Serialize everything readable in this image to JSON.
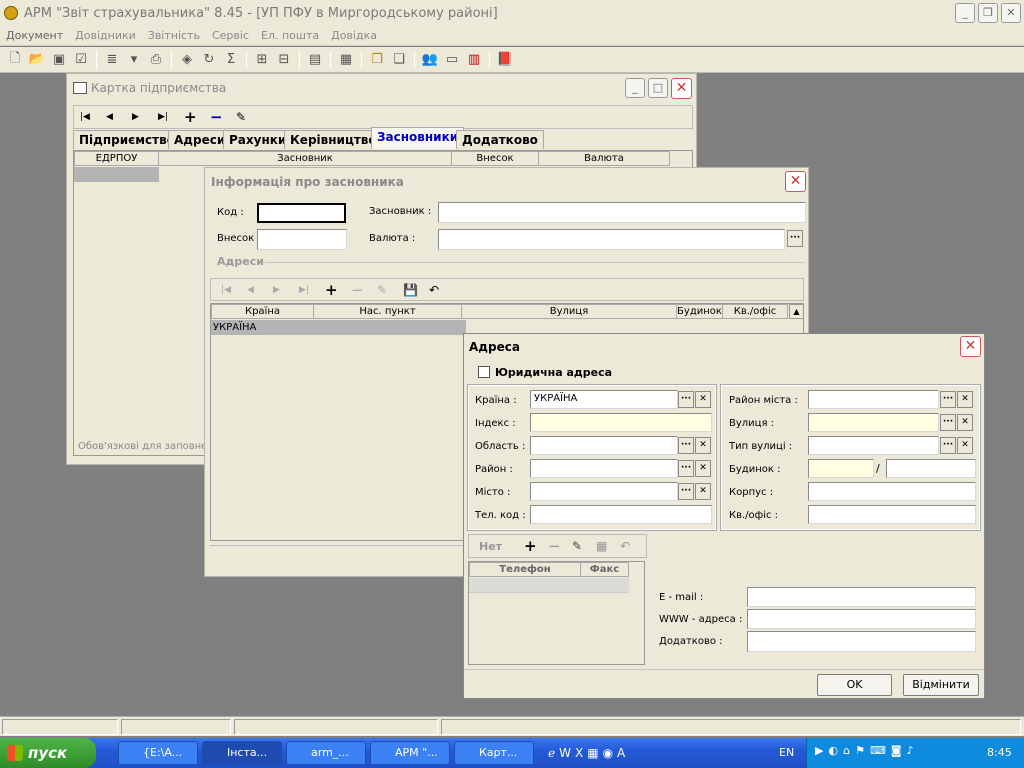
{
  "app": {
    "title": "АРМ \"Звіт страхувальника\" 8.45 - [УП ПФУ в Миргородському районі]"
  },
  "menu": [
    "Документ",
    "Довідники",
    "Звітність",
    "Сервіс",
    "Ел. пошта",
    "Довідка"
  ],
  "card": {
    "title": "Картка підприємства",
    "tabs": [
      "Підприємство",
      "Адреси",
      "Рахунки",
      "Керівництво",
      "Засновники",
      "Додатково"
    ],
    "active_tab": "Засновники",
    "columns": [
      "ЕДРПОУ",
      "Засновник",
      "Внесок",
      "Валюта"
    ],
    "footer_note": "Обов'язкові для заповне"
  },
  "founder": {
    "title": "Інформація про засновника",
    "labels": {
      "kod": "Код :",
      "founder": "Засновник :",
      "vnesok": "Внесок",
      "currency": "Валюта :",
      "addresses": "Адреси"
    },
    "columns": [
      "Країна",
      "Нас. пункт",
      "Вулиця",
      "Будинок",
      "Кв./офіс"
    ],
    "row": {
      "country": "УКРАЇНА"
    }
  },
  "address": {
    "title": "Адреса",
    "legal_checkbox": "Юридична адреса",
    "left_labels": [
      "Країна :",
      "Індекс :",
      "Область :",
      "Район :",
      "Місто :",
      "Тел. код :"
    ],
    "country_value": "УКРАЇНА",
    "right_labels": [
      "Район міста :",
      "Вулиця :",
      "Тип вулиці :",
      "Будинок :",
      "Корпус :",
      "Кв./офіс :"
    ],
    "slash": "/",
    "phones_toolbar_label": "Нет",
    "phone_columns": [
      "Телефон",
      "Факс"
    ],
    "contact_labels": [
      "E - mail :",
      "WWW - адреса :",
      "Додатково :"
    ],
    "ok": "OK",
    "cancel": "Відмінити"
  },
  "taskbar": {
    "start": "пуск",
    "tasks": [
      "{E:\\A...",
      "Інста...",
      "arm_...",
      "АРМ \"...",
      "Карт..."
    ],
    "lang": "EN",
    "clock": "8:45"
  },
  "colors": {
    "taskbar": "#245ad8",
    "start": "#2e8c28",
    "active_tab": "#0000c8",
    "required_field": "#ffffe1"
  }
}
